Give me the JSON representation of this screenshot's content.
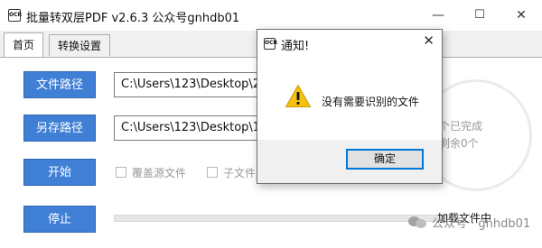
{
  "window": {
    "title": "批量转双层PDF v2.6.3 公众号gnhdb01",
    "controls": {
      "minimize": "—",
      "maximize": "☐",
      "close": "✕"
    }
  },
  "tabs": [
    {
      "label": "首页",
      "active": true
    },
    {
      "label": "转换设置",
      "active": false
    }
  ],
  "main": {
    "source_button": "文件路径",
    "source_path": "C:\\Users\\123\\Desktop\\2",
    "output_button": "另存路径",
    "output_path": "C:\\Users\\123\\Desktop\\1",
    "start_button": "开始",
    "stop_button": "停止",
    "option_overwrite": "覆盖源文件",
    "option_subfolder": "子文件",
    "status_completed": "个已完成",
    "status_remaining": "剩余0个",
    "loading_text": "加载文件中"
  },
  "watermark": {
    "text": "公众号 · gnhdb01"
  },
  "dialog": {
    "title": "通知!",
    "close": "✕",
    "message": "没有需要识别的文件",
    "ok_button": "确定",
    "icon": "warning-icon"
  },
  "colors": {
    "button_blue": "#3f7fd6",
    "warning_yellow": "#f4c20d",
    "focus_border": "#0078d7"
  }
}
